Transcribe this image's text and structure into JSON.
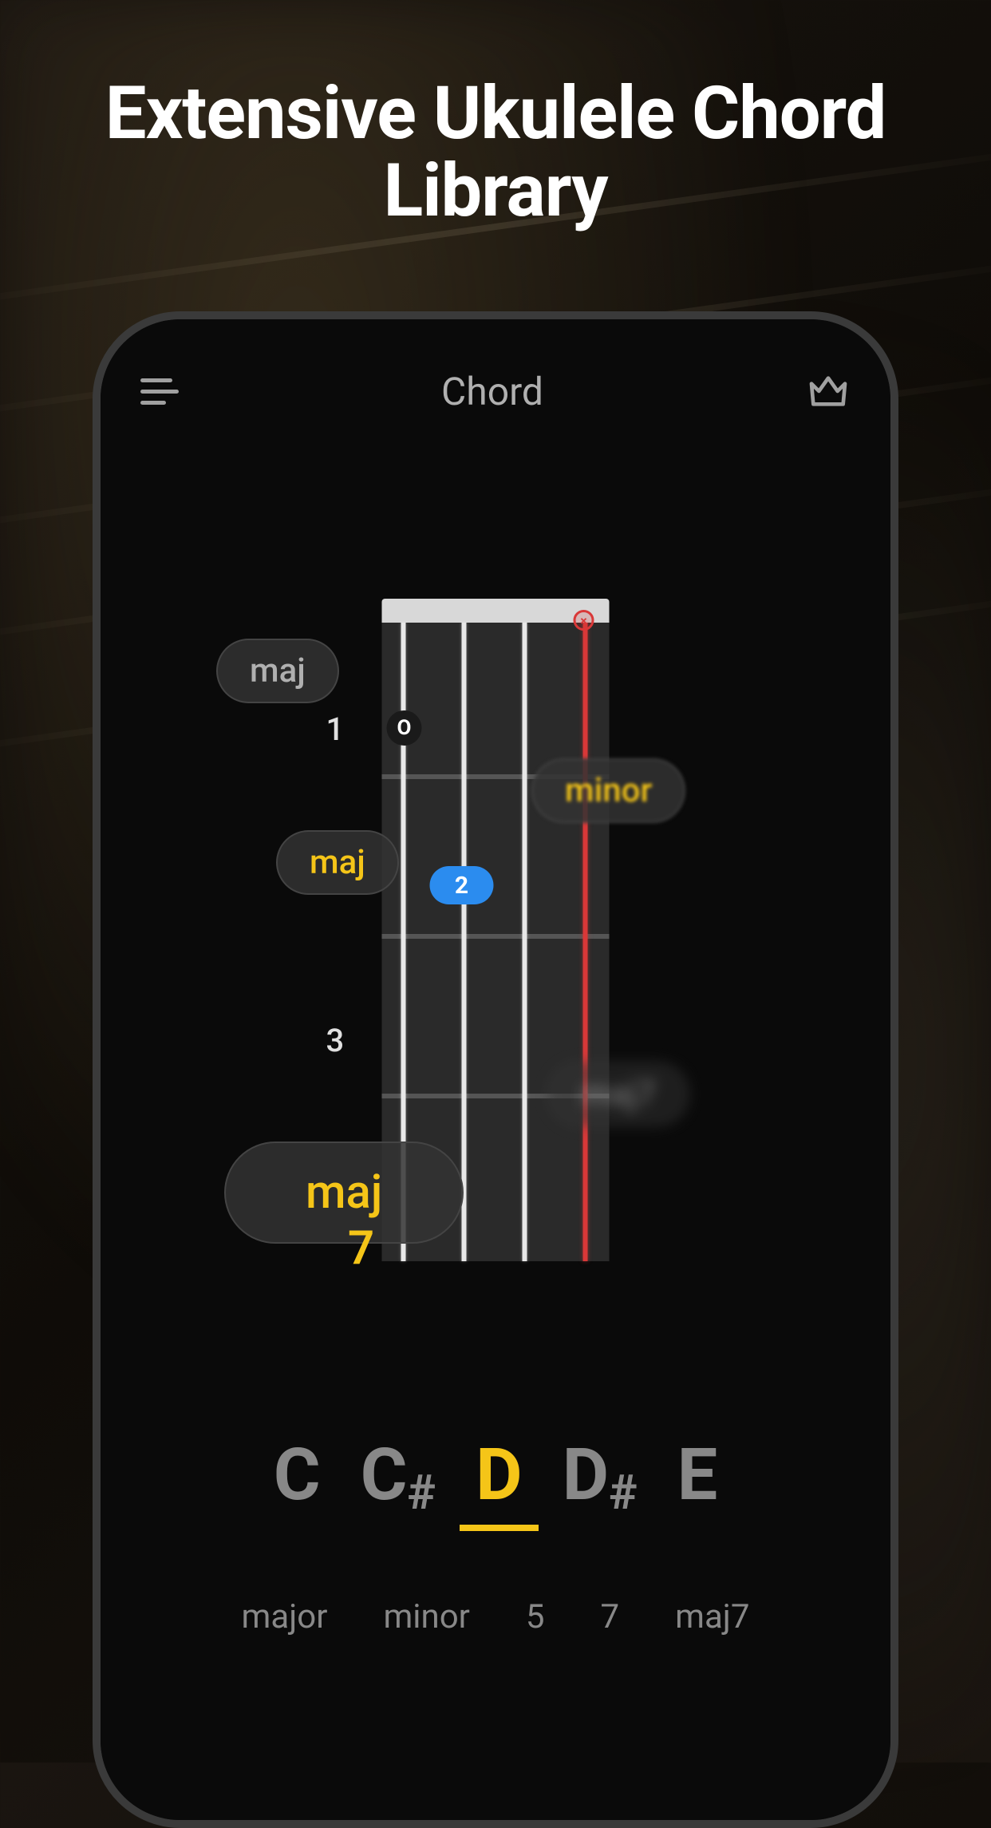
{
  "promo": {
    "title_line1": "Extensive Ukulele Chord",
    "title_line2": "Library"
  },
  "header": {
    "title": "Chord",
    "menu_icon": "menu-icon",
    "crown_icon": "crown-icon"
  },
  "fretboard": {
    "fret_labels": {
      "f1": "1",
      "f3": "3"
    },
    "fingers": {
      "f0": {
        "label": "O"
      },
      "f1": {
        "label": "2"
      }
    }
  },
  "chord_pills": {
    "p1": "maj",
    "p2": "maj",
    "p3": "minor",
    "p4": "maj7",
    "p5": "maj"
  },
  "seven_label": "7",
  "notes": {
    "n1": "C",
    "n2_base": "C",
    "n2_sharp": "#",
    "n3": "D",
    "n4_base": "D",
    "n4_sharp": "#",
    "n5": "E",
    "selected": "D"
  },
  "types": {
    "t1": "major",
    "t2": "minor",
    "t3": "5",
    "t4": "7",
    "t5": "maj7"
  },
  "colors": {
    "accent": "#f5c518",
    "muted_string": "#d93838",
    "finger_blue": "#2b8cef"
  }
}
